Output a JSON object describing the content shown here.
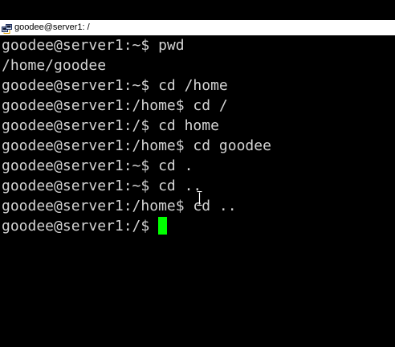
{
  "window": {
    "title": "goodee@server1: /"
  },
  "terminal": {
    "lines": [
      "goodee@server1:~$ pwd",
      "/home/goodee",
      "goodee@server1:~$ cd /home",
      "goodee@server1:/home$ cd /",
      "goodee@server1:/$ cd home",
      "goodee@server1:/home$ cd goodee",
      "goodee@server1:~$ cd .",
      "goodee@server1:~$ cd ..",
      "goodee@server1:/home$ cd .."
    ],
    "prompt": "goodee@server1:/$ ",
    "cursor_color": "#00ff00",
    "text_color": "#d4d4d4",
    "background_color": "#000000"
  }
}
